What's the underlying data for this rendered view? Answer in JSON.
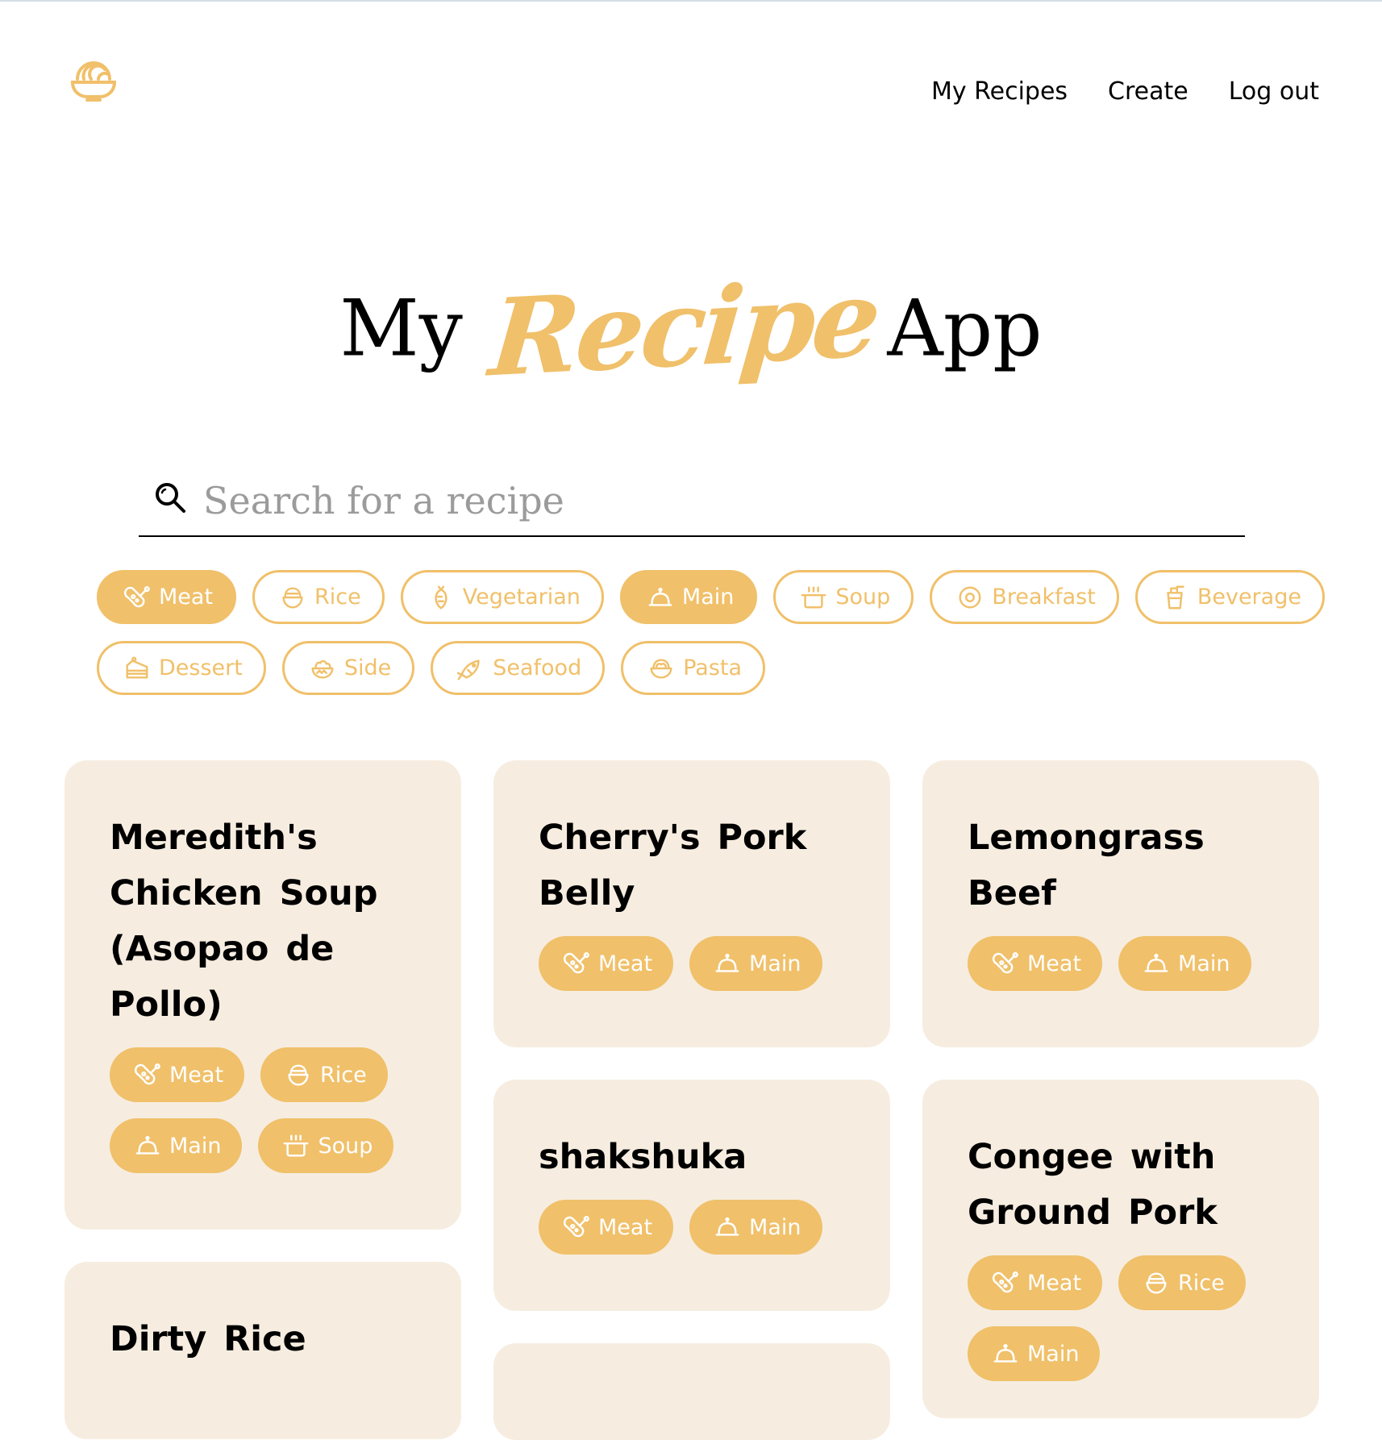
{
  "nav": {
    "my_recipes": "My Recipes",
    "create": "Create",
    "logout": "Log out"
  },
  "hero": {
    "word1": "My",
    "word2": "Recipe",
    "word3": "App"
  },
  "search": {
    "placeholder": "Search for a recipe"
  },
  "filters": [
    {
      "label": "Meat",
      "icon": "meat-icon",
      "active": true
    },
    {
      "label": "Rice",
      "icon": "rice-icon",
      "active": false
    },
    {
      "label": "Vegetarian",
      "icon": "vegetarian-icon",
      "active": false
    },
    {
      "label": "Main",
      "icon": "main-icon",
      "active": true
    },
    {
      "label": "Soup",
      "icon": "soup-icon",
      "active": false
    },
    {
      "label": "Breakfast",
      "icon": "breakfast-icon",
      "active": false
    },
    {
      "label": "Beverage",
      "icon": "beverage-icon",
      "active": false
    },
    {
      "label": "Dessert",
      "icon": "dessert-icon",
      "active": false
    },
    {
      "label": "Side",
      "icon": "side-icon",
      "active": false
    },
    {
      "label": "Seafood",
      "icon": "seafood-icon",
      "active": false
    },
    {
      "label": "Pasta",
      "icon": "pasta-icon",
      "active": false
    }
  ],
  "recipes": [
    {
      "title_lines": [
        "Meredith's",
        "Chicken Soup",
        "(Asopao de",
        "Pollo)"
      ],
      "tags": [
        "Meat",
        "Rice",
        "Main",
        "Soup"
      ]
    },
    {
      "title_lines": [
        "Cherry's Pork",
        "Belly"
      ],
      "tags": [
        "Meat",
        "Main"
      ]
    },
    {
      "title_lines": [
        "Lemongrass",
        "Beef"
      ],
      "tags": [
        "Meat",
        "Main"
      ]
    },
    {
      "title_lines": [
        "shakshuka"
      ],
      "tags": [
        "Meat",
        "Main"
      ]
    },
    {
      "title_lines": [
        "Congee with",
        "Ground Pork"
      ],
      "tags": [
        "Meat",
        "Rice",
        "Main"
      ]
    },
    {
      "title_lines": [
        "Dirty Rice"
      ],
      "tags": []
    }
  ],
  "colors": {
    "accent": "#f0c06a",
    "card_bg": "#f6ede0",
    "text": "#000000"
  }
}
